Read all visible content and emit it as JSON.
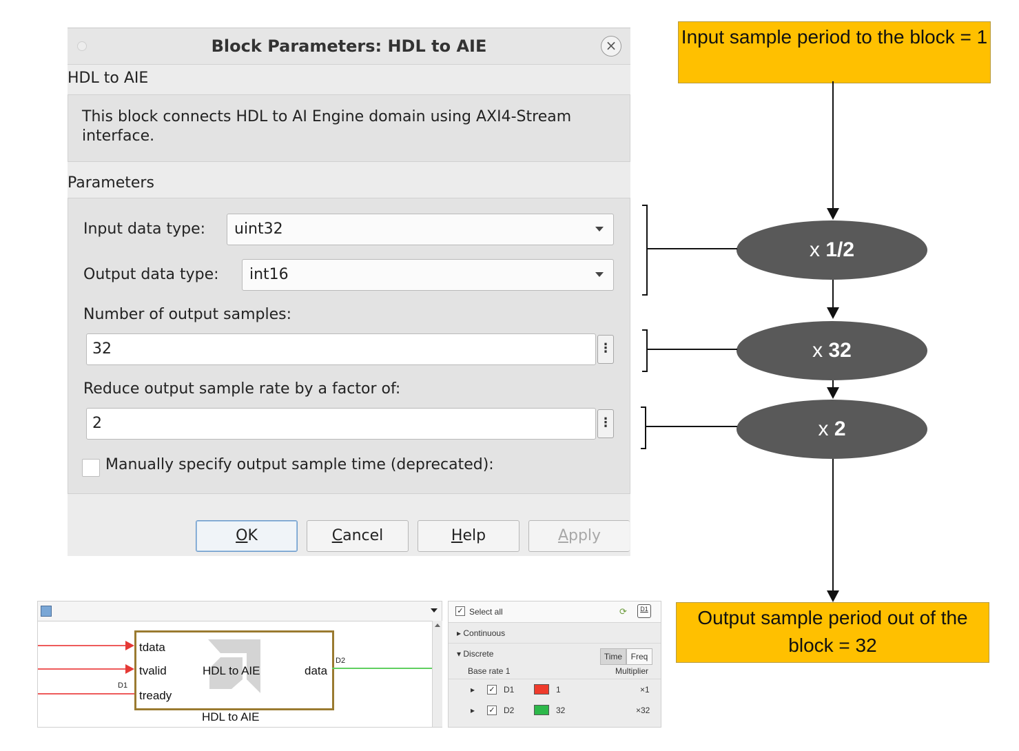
{
  "dialog": {
    "title": "Block Parameters: HDL to AIE",
    "close_glyph": "×",
    "block_name": "HDL to AIE",
    "description": "This block connects HDL to AI Engine domain using AXI4-Stream interface.",
    "parameters_title": "Parameters",
    "input_type_label": "Input data type:",
    "input_type_value": "uint32",
    "output_type_label": "Output data type:",
    "output_type_value": "int16",
    "num_samples_label": "Number of output samples:",
    "num_samples_value": "32",
    "reduce_label": "Reduce output sample rate by a factor of:",
    "reduce_value": "2",
    "more_glyph": "⋮",
    "manual_label": "Manually specify output sample time (deprecated):",
    "manual_checked": false,
    "buttons": {
      "ok_mn": "O",
      "ok_rest": "K",
      "cancel_mn": "C",
      "cancel_rest": "ancel",
      "help_mn": "H",
      "help_rest": "elp",
      "apply_mn": "A",
      "apply_rest": "pply"
    }
  },
  "flow": {
    "input_box": "Input sample period to the block = 1",
    "step1_prefix": "x",
    "step1_value": "1/2",
    "step2_prefix": "x",
    "step2_value": "32",
    "step3_prefix": "x",
    "step3_value": "2",
    "output_box": "Output sample period out of the block = 32"
  },
  "model": {
    "ports_in": [
      "tdata",
      "tvalid",
      "tready"
    ],
    "port_out": "data",
    "block_center_label": "HDL to AIE",
    "block_caption": "HDL to AIE",
    "signal_in_tag": "D1",
    "signal_out_tag": "D2",
    "colors": {
      "input_signal": "#ee5a5a",
      "output_signal": "#5fcf5f",
      "block_border": "#9a7a30"
    }
  },
  "legend": {
    "select_all": "Select all",
    "continuous": "Continuous",
    "discrete": "Discrete",
    "base_rate": "Base rate 1",
    "multiplier": "Multiplier",
    "seg_time": "Time",
    "seg_freq": "Freq",
    "badge": "D1",
    "rows": [
      {
        "name": "D1",
        "value": "1",
        "mult": "×1",
        "color": "#ef3b2c"
      },
      {
        "name": "D2",
        "value": "32",
        "mult": "×32",
        "color": "#2db84a"
      }
    ]
  }
}
